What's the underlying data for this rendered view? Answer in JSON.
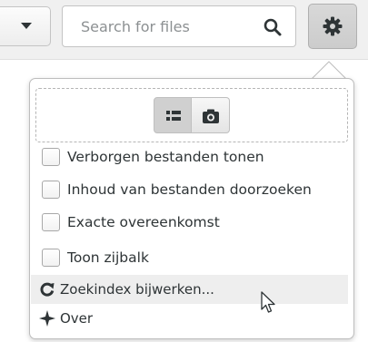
{
  "toolbar": {
    "search": {
      "placeholder": "Search for files",
      "value": ""
    }
  },
  "popover": {
    "view_toggle": [
      {
        "icon": "list-view-icon",
        "active": true
      },
      {
        "icon": "camera-icon",
        "active": false
      }
    ],
    "options": [
      {
        "label": "Verborgen bestanden tonen",
        "checked": false
      },
      {
        "label": "Inhoud van bestanden doorzoeken",
        "checked": false
      },
      {
        "label": "Exacte overeenkomst",
        "checked": false
      },
      {
        "label": "Toon zijbalk",
        "checked": false
      }
    ],
    "menu": [
      {
        "icon": "refresh-icon",
        "label": "Zoekindex bijwerken..."
      },
      {
        "icon": "sparkle-icon",
        "label": "Over"
      }
    ]
  },
  "colors": {
    "text": "#2e3436",
    "toolbar_bg": "#f0f0f0",
    "hover_bg": "#eeeeee",
    "border": "#bdbdbd"
  }
}
